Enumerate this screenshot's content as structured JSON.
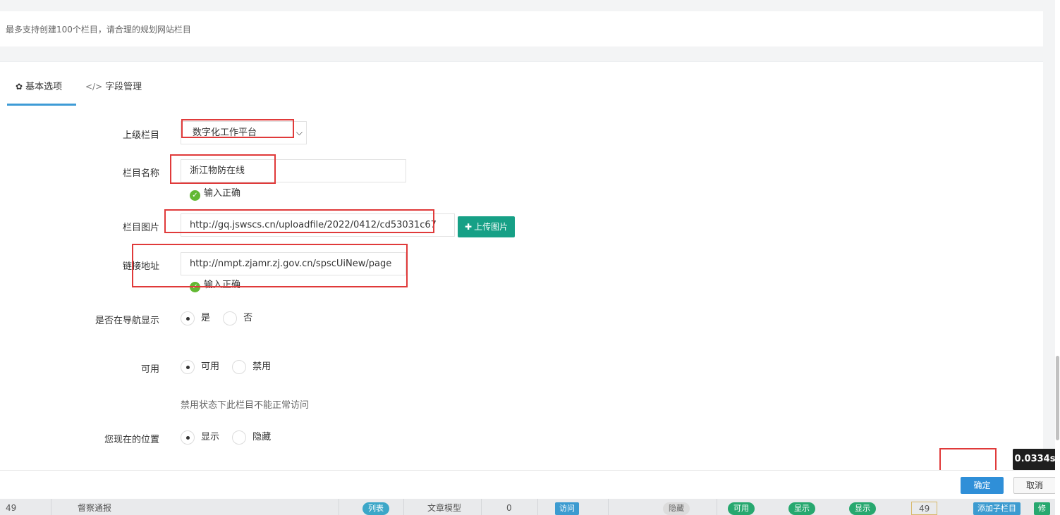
{
  "hint": "最多支持创建100个栏目，请合理的规划网站栏目",
  "tabs": [
    {
      "label": "基本选项",
      "icon": "gear-icon"
    },
    {
      "label": "字段管理",
      "icon": "code-icon"
    }
  ],
  "form": {
    "parent": {
      "label": "上级栏目",
      "value": "数字化工作平台"
    },
    "name": {
      "label": "栏目名称",
      "value": "浙江物防在线",
      "ok": "输入正确"
    },
    "image": {
      "label": "栏目图片",
      "value": "http://gq.jswscs.cn/uploadfile/2022/0412/cd53031c67",
      "upload": "上传图片"
    },
    "link": {
      "label": "链接地址",
      "value": "http://nmpt.zjamr.zj.gov.cn/spscUiNew/page",
      "ok": "输入正确"
    },
    "nav": {
      "label": "是否在导航显示",
      "options": [
        "是",
        "否"
      ],
      "selected": "是"
    },
    "enabled": {
      "label": "可用",
      "options": [
        "可用",
        "禁用"
      ],
      "selected": "可用",
      "note": "禁用状态下此栏目不能正常访问"
    },
    "position": {
      "label": "您现在的位置",
      "options": [
        "显示",
        "隐藏"
      ],
      "selected": "显示"
    }
  },
  "footer": {
    "confirm": "确定",
    "cancel": "取消"
  },
  "timer": "0.0334s",
  "background_row": {
    "id": "49",
    "name": "督察通报",
    "type_badge": "列表",
    "model": "文章模型",
    "count": "0",
    "access_badge": "访问",
    "hidden_toggle": "隐藏",
    "toggle_1": "可用",
    "toggle_2": "显示",
    "toggle_3": "显示",
    "sort_value": "49",
    "add_child": "添加子栏目",
    "edit": "修"
  },
  "colors": {
    "accent_tab": "#3e9bd6",
    "upload_button": "#16a086",
    "confirm_button": "#2f8fd8",
    "ok_icon": "#62b832",
    "annotation_red": "#e03a3a"
  }
}
